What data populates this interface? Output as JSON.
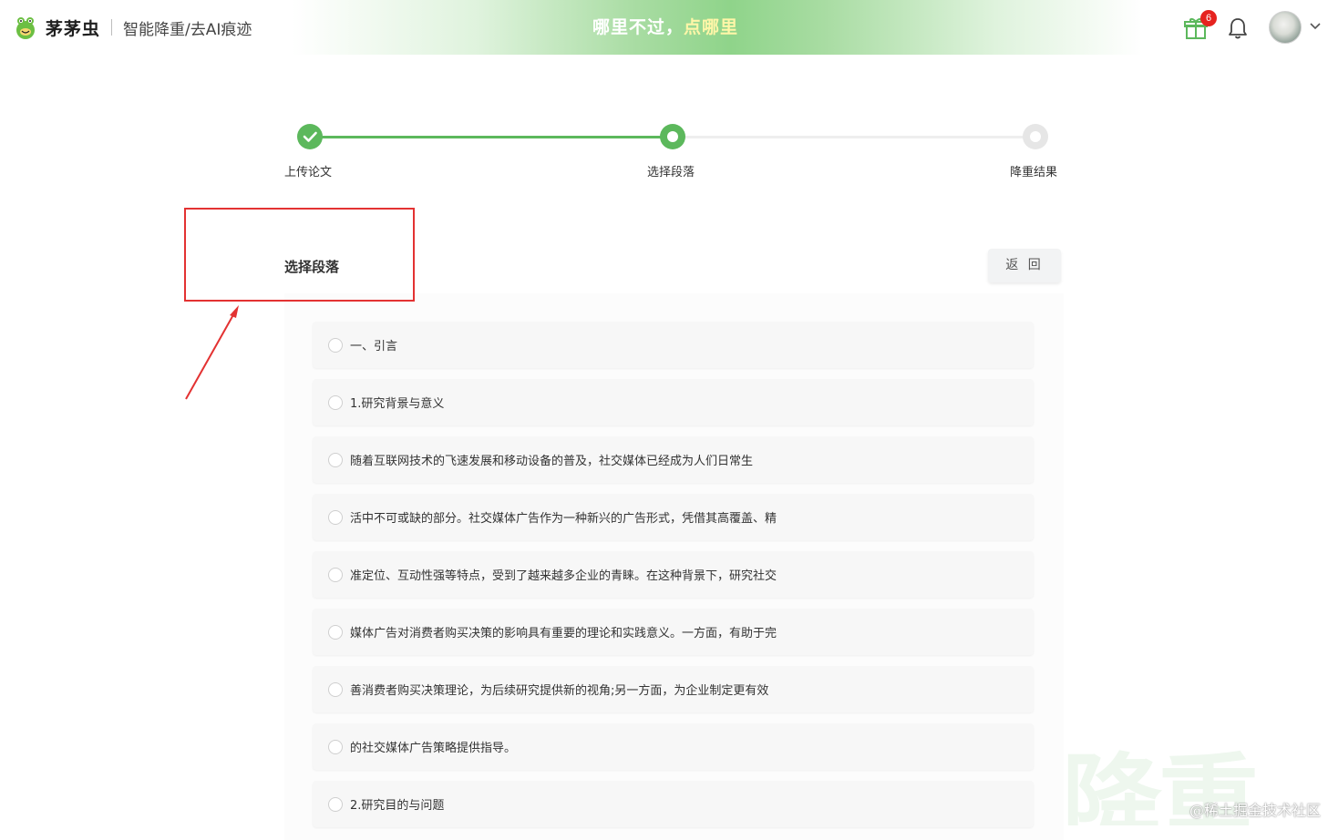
{
  "header": {
    "brand_name": "茅茅虫",
    "brand_subtitle": "智能降重/去AI痕迹",
    "banner_part1": "哪里不过，",
    "banner_part2": "点哪里",
    "gift_badge_count": "6",
    "accent_color": "#5cb85c"
  },
  "stepper": {
    "steps": [
      {
        "label": "上传论文",
        "state": "done"
      },
      {
        "label": "选择段落",
        "state": "active"
      },
      {
        "label": "降重结果",
        "state": "pending"
      }
    ]
  },
  "main": {
    "section_title": "选择段落",
    "back_label": "返 回",
    "paragraphs": [
      "一、引言",
      "1.研究背景与意义",
      "随着互联网技术的飞速发展和移动设备的普及，社交媒体已经成为人们日常生",
      "活中不可或缺的部分。社交媒体广告作为一种新兴的广告形式，凭借其高覆盖、精",
      "准定位、互动性强等特点，受到了越来越多企业的青睐。在这种背景下，研究社交",
      "媒体广告对消费者购买决策的影响具有重要的理论和实践意义。一方面，有助于完",
      "善消费者购买决策理论，为后续研究提供新的视角;另一方面，为企业制定更有效",
      "的社交媒体广告策略提供指导。",
      "2.研究目的与问题"
    ]
  },
  "watermark": {
    "text": "@稀土掘金技术社区",
    "big_text": "降重"
  }
}
